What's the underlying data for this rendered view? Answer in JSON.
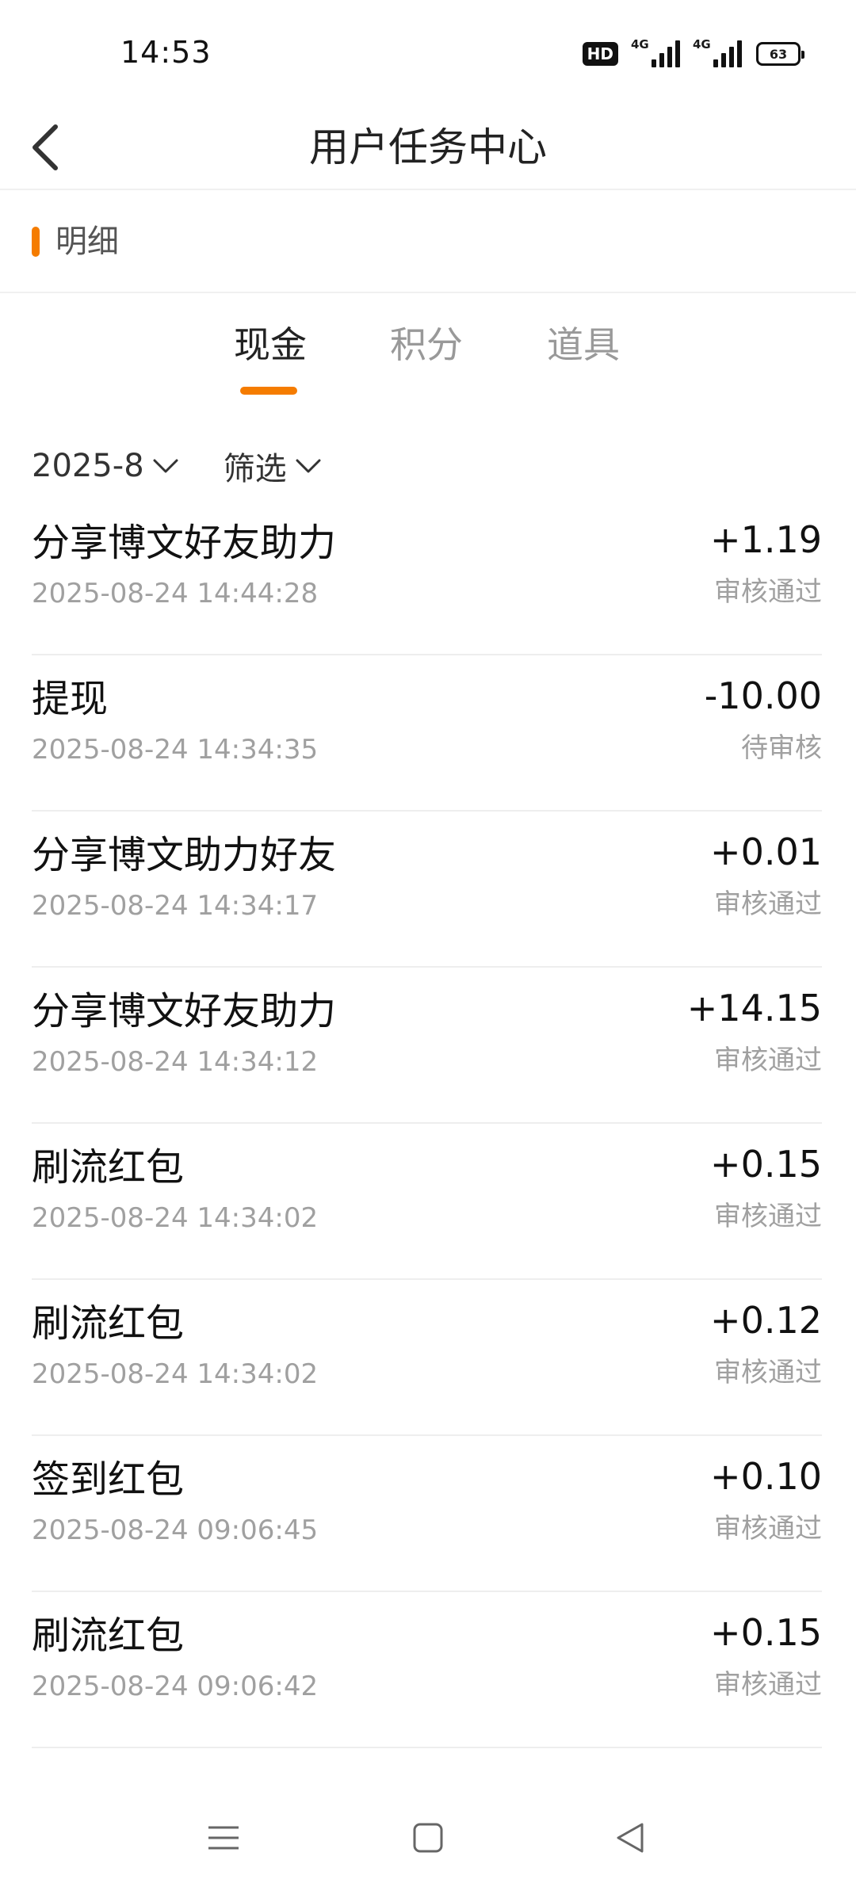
{
  "status_bar": {
    "time": "14:53",
    "hd_label": "HD",
    "network_1": "4G",
    "network_2": "4G",
    "battery": "63"
  },
  "header": {
    "title": "用户任务中心",
    "back_icon": "chevron-left-icon"
  },
  "section": {
    "label": "明细",
    "accent_color": "#f57c00"
  },
  "tabs": [
    {
      "label": "现金",
      "active": true
    },
    {
      "label": "积分",
      "active": false
    },
    {
      "label": "道具",
      "active": false
    }
  ],
  "filters": {
    "month": "2025-8",
    "filter_label": "筛选"
  },
  "records": [
    {
      "title": "分享博文好友助力",
      "time": "2025-08-24 14:44:28",
      "amount": "+1.19",
      "status": "审核通过"
    },
    {
      "title": "提现",
      "time": "2025-08-24 14:34:35",
      "amount": "-10.00",
      "status": "待审核"
    },
    {
      "title": "分享博文助力好友",
      "time": "2025-08-24 14:34:17",
      "amount": "+0.01",
      "status": "审核通过"
    },
    {
      "title": "分享博文好友助力",
      "time": "2025-08-24 14:34:12",
      "amount": "+14.15",
      "status": "审核通过"
    },
    {
      "title": "刷流红包",
      "time": "2025-08-24 14:34:02",
      "amount": "+0.15",
      "status": "审核通过"
    },
    {
      "title": "刷流红包",
      "time": "2025-08-24 14:34:02",
      "amount": "+0.12",
      "status": "审核通过"
    },
    {
      "title": "签到红包",
      "time": "2025-08-24 09:06:45",
      "amount": "+0.10",
      "status": "审核通过"
    },
    {
      "title": "刷流红包",
      "time": "2025-08-24 09:06:42",
      "amount": "+0.15",
      "status": "审核通过"
    }
  ],
  "nav": {
    "menu_icon": "menu-icon",
    "home_icon": "home-square-icon",
    "back_icon": "back-triangle-icon"
  }
}
